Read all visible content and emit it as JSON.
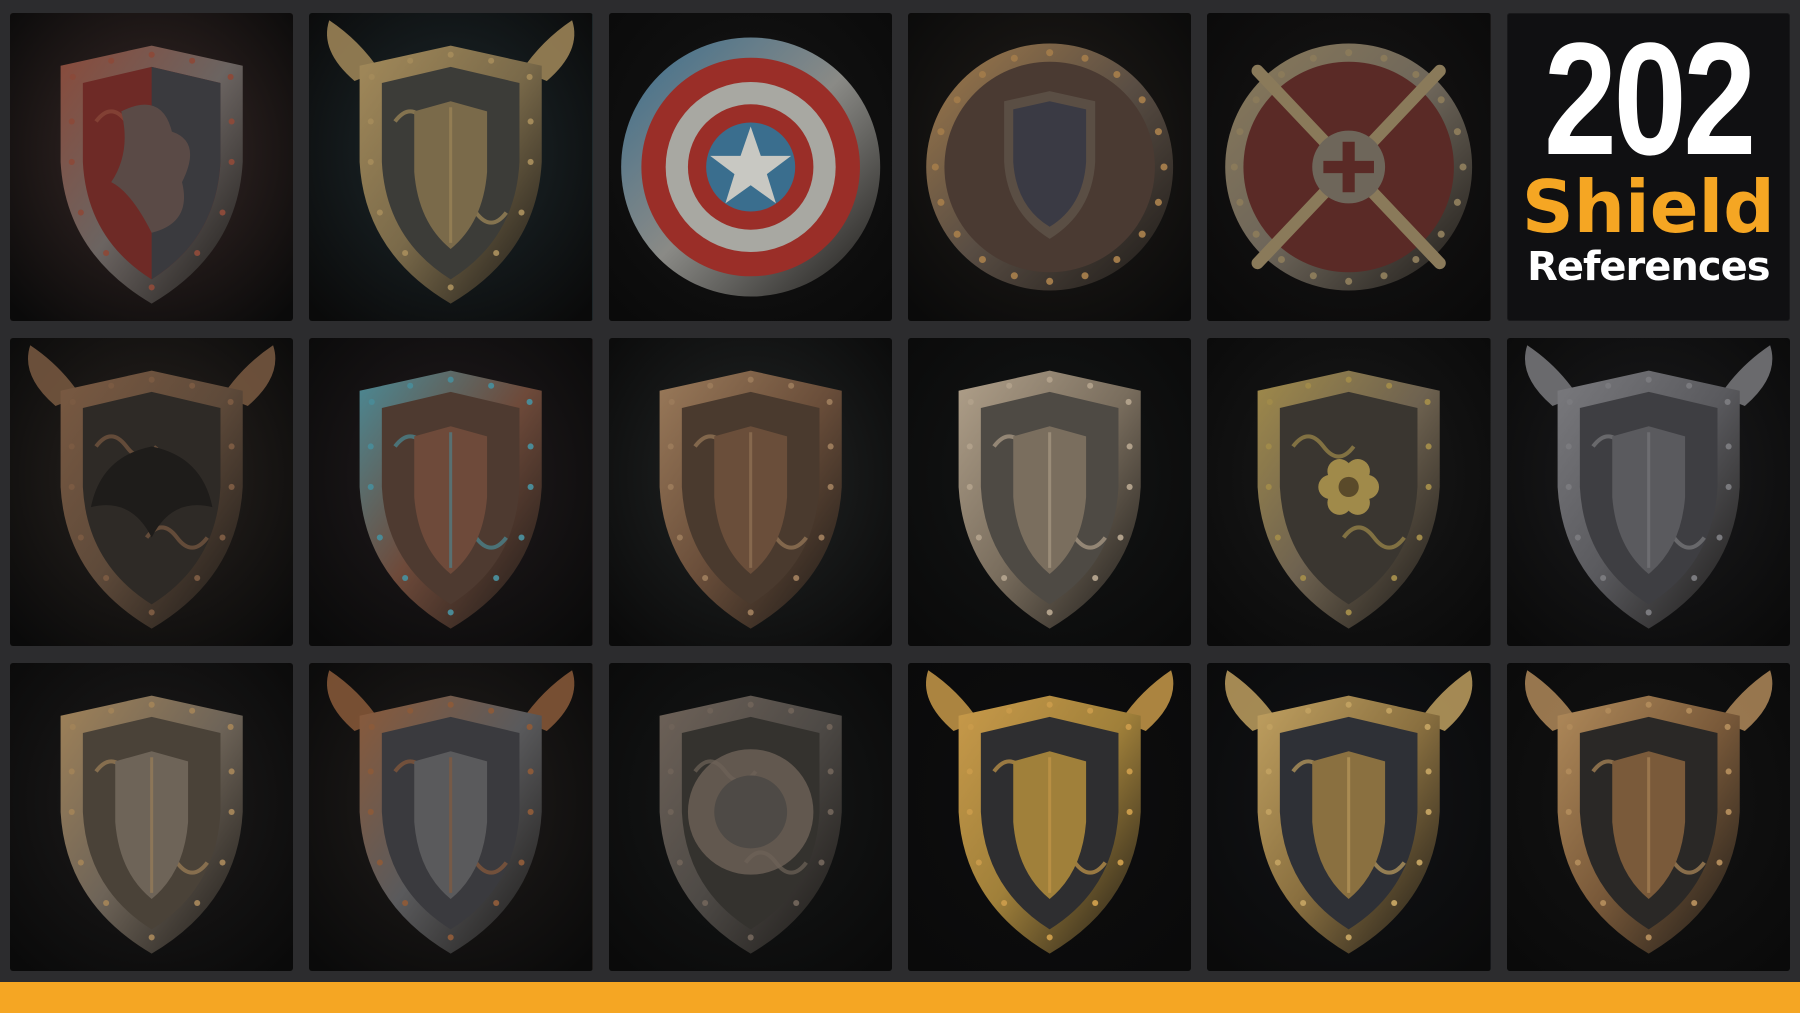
{
  "banner": {
    "count": "202",
    "word": "Shield",
    "subtitle": "References"
  },
  "colors": {
    "background": "#2c2c2e",
    "accent": "#f5a623",
    "title_text": "#ffffff"
  },
  "tiles": [
    {
      "subject": "red-dragon-shield",
      "bg": "#3a2a28",
      "metal": "#6b6461",
      "field": "#6e2a26",
      "accent": "#8a4a3a"
    },
    {
      "subject": "horned-gold-shield",
      "bg": "#1e2a2e",
      "metal": "#7a6a4a",
      "field": "#3c3c38",
      "accent": "#a38a5a"
    },
    {
      "subject": "star-round-shield",
      "bg": "#161616",
      "metal": "#8a8a86",
      "field": "#9a2e28",
      "accent": "#3a6e8e"
    },
    {
      "subject": "round-crest-shield",
      "bg": "#221e1a",
      "metal": "#5a4e44",
      "field": "#4a3a32",
      "accent": "#a07a4a"
    },
    {
      "subject": "crossed-swords-shield",
      "bg": "#181616",
      "metal": "#6e665a",
      "field": "#5a2a26",
      "accent": "#8a7a5a"
    },
    {
      "subject": "title-card"
    },
    {
      "subject": "eagle-shield",
      "bg": "#2a2420",
      "metal": "#5e4a3a",
      "field": "#2e2a26",
      "accent": "#7a5a42"
    },
    {
      "subject": "teal-copper-shield",
      "bg": "#221c1e",
      "metal": "#6e4a3a",
      "field": "#4e3a30",
      "accent": "#4a8a96"
    },
    {
      "subject": "ornate-bronze-shield",
      "bg": "#232626",
      "metal": "#6a4e3a",
      "field": "#4a3a2e",
      "accent": "#9a7a5a"
    },
    {
      "subject": "filigree-steel-shield",
      "bg": "#141616",
      "metal": "#7a6e5e",
      "field": "#4e4a44",
      "accent": "#b0a08a"
    },
    {
      "subject": "floral-shield",
      "bg": "#1a1a1a",
      "metal": "#6e6250",
      "field": "#3a3630",
      "accent": "#a08a4a"
    },
    {
      "subject": "horned-helm-shield",
      "bg": "#1c1c1e",
      "metal": "#5a5a5e",
      "field": "#3e3e42",
      "accent": "#7a7a7e"
    },
    {
      "subject": "spiked-steel-shield",
      "bg": "#1e1c1c",
      "metal": "#6e6458",
      "field": "#4a4238",
      "accent": "#a08258"
    },
    {
      "subject": "winged-dark-shield",
      "bg": "#221e1c",
      "metal": "#5a5a5c",
      "field": "#3a3a3e",
      "accent": "#8a5a3a"
    },
    {
      "subject": "lion-shield",
      "bg": "#161818",
      "metal": "#4e4a46",
      "field": "#34322e",
      "accent": "#6e6258"
    },
    {
      "subject": "gold-winged-shield",
      "bg": "#0e0e10",
      "metal": "#a0803a",
      "field": "#2e2e30",
      "accent": "#c89a4a"
    },
    {
      "subject": "gold-eagle-shield",
      "bg": "#121418",
      "metal": "#8a7040",
      "field": "#2e3036",
      "accent": "#c0a060"
    },
    {
      "subject": "bronze-horn-shield",
      "bg": "#141414",
      "metal": "#7a5a3a",
      "field": "#2a2826",
      "accent": "#b08a5a"
    }
  ]
}
